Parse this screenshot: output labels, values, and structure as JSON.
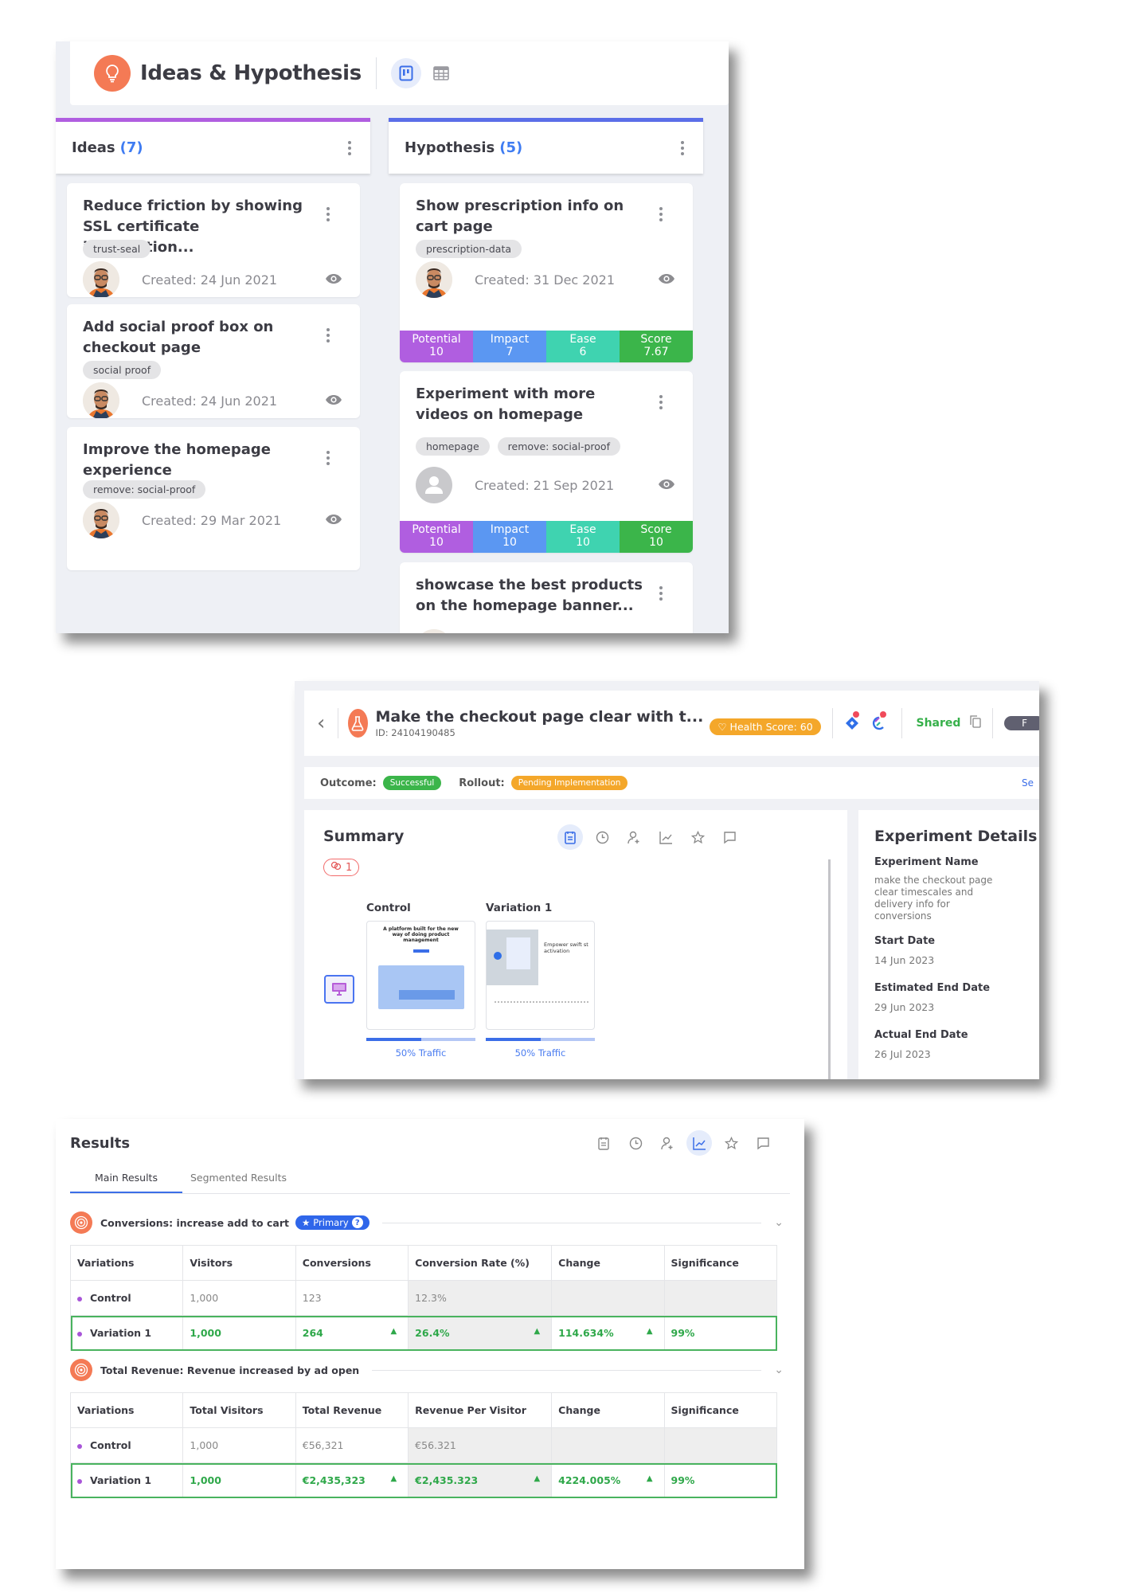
{
  "ideas_board": {
    "title": "Ideas & Hypothesis",
    "icons": {
      "header": "lightbulb-icon",
      "view_board": "kanban-board-icon",
      "view_table": "table-grid-icon"
    },
    "columns": [
      {
        "label": "Ideas",
        "count": "(7)",
        "accent": "#b05ee0",
        "cards": [
          {
            "title": "Reduce friction by showing SSL certificate information...",
            "tags": [
              "trust-seal"
            ],
            "created": "Created: 24 Jun 2021",
            "avatar": "user-photo"
          },
          {
            "title": "Add social proof box on checkout page",
            "tags": [
              "social proof"
            ],
            "created": "Created: 24 Jun 2021",
            "avatar": "user-photo"
          },
          {
            "title": "Improve the homepage experience",
            "tags": [
              "remove: social-proof"
            ],
            "created": "Created: 29 Mar 2021",
            "avatar": "user-photo"
          }
        ]
      },
      {
        "label": "Hypothesis",
        "count": "(5)",
        "accent": "#5b6ee8",
        "cards": [
          {
            "title": "Show prescription info on cart page",
            "tags": [
              "prescription-data"
            ],
            "created": "Created: 31 Dec 2021",
            "avatar": "user-photo",
            "scores": [
              {
                "label": "Potential",
                "value": "10"
              },
              {
                "label": "Impact",
                "value": "7"
              },
              {
                "label": "Ease",
                "value": "6"
              },
              {
                "label": "Score",
                "value": "7.67"
              }
            ]
          },
          {
            "title": "Experiment with more videos on homepage",
            "tags": [
              "homepage",
              "remove: social-proof"
            ],
            "created": "Created: 21 Sep 2021",
            "avatar": "default-user",
            "scores": [
              {
                "label": "Potential",
                "value": "10"
              },
              {
                "label": "Impact",
                "value": "10"
              },
              {
                "label": "Ease",
                "value": "10"
              },
              {
                "label": "Score",
                "value": "10"
              }
            ]
          },
          {
            "title": "showcase the best products on the homepage banner...",
            "tags": [],
            "created": "",
            "avatar": "user-photo"
          }
        ]
      }
    ],
    "score_colors": {
      "potential": "#b05ee0",
      "impact": "#5b97f2",
      "ease": "#3fd3b0",
      "score": "#3bb54a"
    }
  },
  "experiment": {
    "title": "Make the checkout page clear with t...",
    "id": "ID: 24104190485",
    "health_score": "Health Score: 60",
    "shared_label": "Shared",
    "cut_button": "F",
    "outcome_label": "Outcome:",
    "outcome_value": "Successful",
    "rollout_label": "Rollout:",
    "rollout_value": "Pending Implementation",
    "see_link": "Se",
    "colors": {
      "successful": "#3bb54a",
      "pending": "#f4a72a",
      "health": "#f4a72a"
    },
    "summary": {
      "title": "Summary",
      "goal_count": "1",
      "tool_icons": [
        "notes-icon",
        "clock-icon",
        "user-add-icon",
        "chart-icon",
        "star-icon",
        "comment-icon"
      ],
      "active_tool": "notes-icon",
      "variants": [
        {
          "label": "Control",
          "traffic_label": "50% Traffic",
          "traffic": 0.5,
          "thumb_headline": "A platform built for the new way of doing product management"
        },
        {
          "label": "Variation 1",
          "traffic_label": "50% Traffic",
          "traffic": 0.5,
          "thumb_headline": "Empower swift st activation"
        }
      ]
    },
    "details": {
      "title": "Experiment Details",
      "fields": [
        {
          "label": "Experiment Name",
          "value": "make the checkout page clear timescales and delivery info for conversions"
        },
        {
          "label": "Start Date",
          "value": "14 Jun 2023"
        },
        {
          "label": "Estimated End Date",
          "value": "29 Jun 2023"
        },
        {
          "label": "Actual End Date",
          "value": "26 Jul 2023"
        }
      ]
    }
  },
  "results": {
    "title": "Results",
    "active_tool": "chart-icon",
    "tabs": [
      {
        "label": "Main Results",
        "active": true
      },
      {
        "label": "Segmented Results",
        "active": false
      }
    ],
    "goals": [
      {
        "name": "Conversions: increase add to cart",
        "primary_label": "Primary",
        "columns": [
          "Variations",
          "Visitors",
          "Conversions",
          "Conversion Rate (%)",
          "Change",
          "Significance"
        ],
        "rows": [
          {
            "variation": "Control",
            "cells": [
              "1,000",
              "123",
              "12.3%",
              "",
              ""
            ],
            "winner": false
          },
          {
            "variation": "Variation 1",
            "cells": [
              "1,000",
              "264",
              "26.4%",
              "114.634%",
              "99%"
            ],
            "winner": true
          }
        ]
      },
      {
        "name": "Total Revenue: Revenue increased by ad open",
        "primary_label": "",
        "columns": [
          "Variations",
          "Total Visitors",
          "Total Revenue",
          "Revenue Per Visitor",
          "Change",
          "Significance"
        ],
        "rows": [
          {
            "variation": "Control",
            "cells": [
              "1,000",
              "€56,321",
              "€56.321",
              "",
              ""
            ],
            "winner": false
          },
          {
            "variation": "Variation 1",
            "cells": [
              "1,000",
              "€2,435,323",
              "€2,435.323",
              "4224.005%",
              "99%"
            ],
            "winner": true
          }
        ]
      }
    ]
  }
}
